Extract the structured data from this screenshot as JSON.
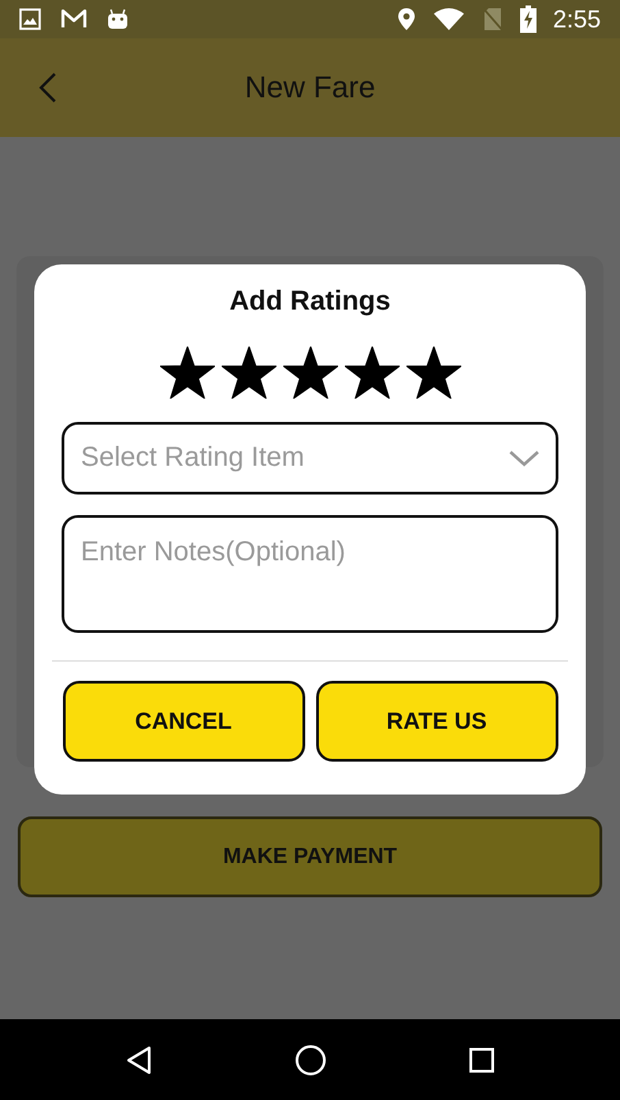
{
  "status_bar": {
    "time": "2:55"
  },
  "app_bar": {
    "title": "New Fare"
  },
  "make_payment_button": {
    "label": "MAKE PAYMENT"
  },
  "dialog": {
    "title": "Add Ratings",
    "stars": 5,
    "rating_item": {
      "placeholder": "Select Rating Item"
    },
    "notes": {
      "placeholder": "Enter Notes(Optional)"
    },
    "buttons": [
      "CANCEL",
      "RATE US"
    ]
  }
}
